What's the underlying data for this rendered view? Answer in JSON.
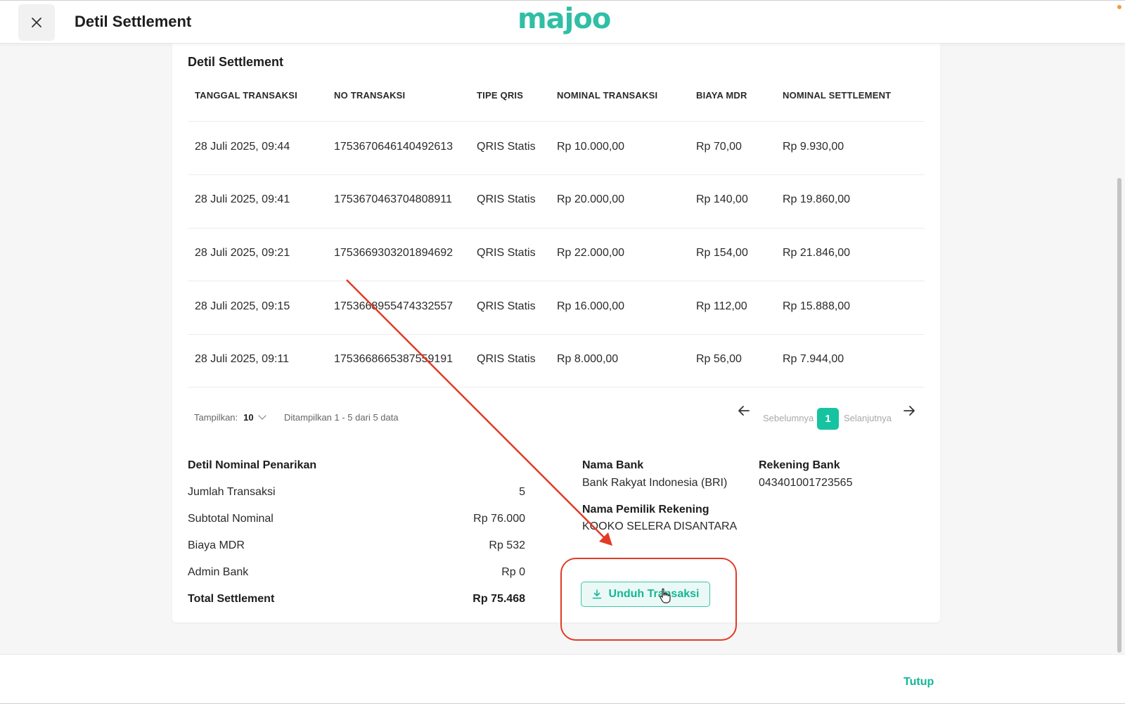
{
  "header": {
    "title": "Detil Settlement",
    "logo": "majoo",
    "close_icon": "close-icon"
  },
  "table": {
    "title": "Detil Settlement",
    "columns": [
      "TANGGAL TRANSAKSI",
      "NO TRANSAKSI",
      "TIPE QRIS",
      "NOMINAL TRANSAKSI",
      "BIAYA MDR",
      "NOMINAL SETTLEMENT"
    ],
    "rows": [
      [
        "28 Juli 2025, 09:44",
        "1753670646140492613",
        "QRIS Statis",
        "Rp 10.000,00",
        "Rp 70,00",
        "Rp 9.930,00"
      ],
      [
        "28 Juli 2025, 09:41",
        "1753670463704808911",
        "QRIS Statis",
        "Rp 20.000,00",
        "Rp 140,00",
        "Rp 19.860,00"
      ],
      [
        "28 Juli 2025, 09:21",
        "1753669303201894692",
        "QRIS Statis",
        "Rp 22.000,00",
        "Rp 154,00",
        "Rp 21.846,00"
      ],
      [
        "28 Juli 2025, 09:15",
        "1753668955474332557",
        "QRIS Statis",
        "Rp 16.000,00",
        "Rp 112,00",
        "Rp 15.888,00"
      ],
      [
        "28 Juli 2025, 09:11",
        "1753668665387559191",
        "QRIS Statis",
        "Rp 8.000,00",
        "Rp 56,00",
        "Rp 7.944,00"
      ]
    ]
  },
  "pagination": {
    "show_label": "Tampilkan:",
    "page_size": "10",
    "info": "Ditampilkan 1 - 5 dari 5 data",
    "prev_label": "Sebelumnya",
    "current_page": "1",
    "next_label": "Selanjutnya"
  },
  "summary": {
    "title": "Detil Nominal Penarikan",
    "items": [
      {
        "label": "Jumlah Transaksi",
        "value": "5"
      },
      {
        "label": "Subtotal Nominal",
        "value": "Rp 76.000"
      },
      {
        "label": "Biaya MDR",
        "value": "Rp 532"
      },
      {
        "label": "Admin Bank",
        "value": "Rp 0"
      }
    ],
    "total_label": "Total Settlement",
    "total_value": "Rp 75.468"
  },
  "bank": {
    "bank_name_label": "Nama Bank",
    "bank_name": "Bank Rakyat Indonesia (BRI)",
    "account_label": "Rekening Bank",
    "account_number": "043401001723565",
    "owner_label": "Nama Pemilik Rekening",
    "owner_name": "KOOKO SELERA DISANTARA"
  },
  "actions": {
    "download_label": "Unduh Transaksi",
    "close_label": "Tutup"
  },
  "colors": {
    "accent": "#15c3a0",
    "annotation": "#e23a25"
  }
}
